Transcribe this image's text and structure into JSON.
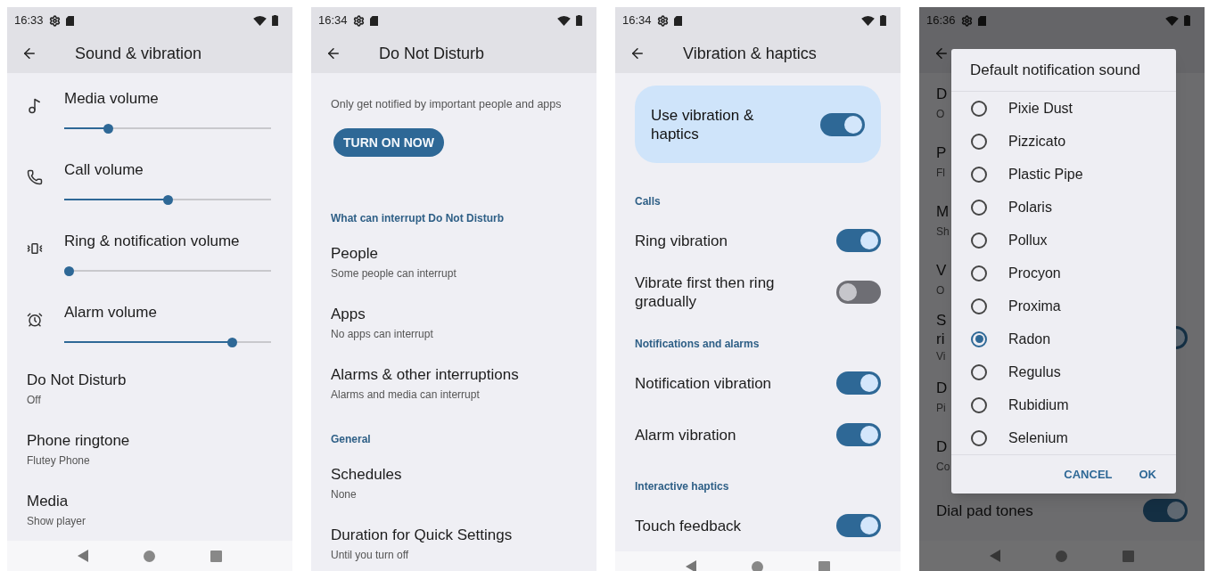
{
  "screens": [
    {
      "kind": "list",
      "time": "16:33",
      "title": "Sound & vibration",
      "items": [
        {
          "kind": "slider",
          "title": "Media volume",
          "level": 0.2
        },
        {
          "kind": "slider",
          "title": "Call volume",
          "level": 0.5
        },
        {
          "kind": "slider",
          "title": "Ring & notification volume",
          "level": 0
        },
        {
          "kind": "slider",
          "title": "Alarm volume",
          "level": 0.83
        },
        {
          "kind": "text",
          "title": "Do Not Disturb",
          "subtitle": "Off"
        },
        {
          "kind": "text",
          "title": "Phone ringtone",
          "subtitle": "Flutey Phone"
        },
        {
          "kind": "text",
          "title": "Media",
          "subtitle": "Show player"
        }
      ]
    },
    {
      "kind": "list",
      "time": "16:34",
      "title": "Do Not Disturb",
      "items": [
        {
          "kind": "note",
          "title": "Only get notified by important people and apps"
        },
        {
          "kind": "button",
          "title": "TURN ON NOW"
        },
        {
          "kind": "header",
          "title": "What can interrupt Do Not Disturb"
        },
        {
          "kind": "text",
          "title": "People",
          "subtitle": "Some people can interrupt"
        },
        {
          "kind": "text",
          "title": "Apps",
          "subtitle": "No apps can interrupt"
        },
        {
          "kind": "text",
          "title": "Alarms & other interruptions",
          "subtitle": "Alarms and media can interrupt"
        },
        {
          "kind": "header",
          "title": "General"
        },
        {
          "kind": "text",
          "title": "Schedules",
          "subtitle": "None"
        },
        {
          "kind": "text",
          "title": "Duration for Quick Settings",
          "subtitle": "Until you turn off"
        }
      ]
    },
    {
      "kind": "list",
      "time": "16:34",
      "title": "Vibration & haptics",
      "items": [
        {
          "kind": "card",
          "title": "Use vibration & haptics",
          "on": true
        },
        {
          "kind": "header",
          "title": "Calls"
        },
        {
          "kind": "switch",
          "title": "Ring vibration",
          "on": true
        },
        {
          "kind": "switch",
          "title": "Vibrate first then ring gradually",
          "on": false
        },
        {
          "kind": "header",
          "title": "Notifications and alarms"
        },
        {
          "kind": "switch",
          "title": "Notification vibration",
          "on": true
        },
        {
          "kind": "switch",
          "title": "Alarm vibration",
          "on": true
        },
        {
          "kind": "header",
          "title": "Interactive haptics"
        },
        {
          "kind": "switch",
          "title": "Touch feedback",
          "on": true
        }
      ]
    },
    {
      "kind": "dialog",
      "time": "16:36",
      "items": [
        {
          "kind": "text",
          "title": "D",
          "subtitle": "O"
        },
        {
          "kind": "text",
          "title": "P",
          "subtitle": "Fl"
        },
        {
          "kind": "text",
          "title": "M",
          "subtitle": "Sh"
        },
        {
          "kind": "text",
          "title": "V",
          "subtitle": "O"
        },
        {
          "kind": "switch",
          "title": "S",
          "title_line_2": "ri",
          "subtitle": "Vi",
          "on": true
        },
        {
          "kind": "text",
          "title": "D",
          "subtitle": "Pi"
        },
        {
          "kind": "text",
          "title": "D",
          "subtitle": "Co"
        },
        {
          "kind": "switch",
          "title": "Dial pad tones",
          "on": true
        }
      ],
      "dialog": {
        "title": "Default notification sound",
        "options": [
          {
            "label": "Pixie Dust",
            "selected": false
          },
          {
            "label": "Pizzicato",
            "selected": false
          },
          {
            "label": "Plastic Pipe",
            "selected": false
          },
          {
            "label": "Polaris",
            "selected": false
          },
          {
            "label": "Pollux",
            "selected": false
          },
          {
            "label": "Procyon",
            "selected": false
          },
          {
            "label": "Proxima",
            "selected": false
          },
          {
            "label": "Radon",
            "selected": true
          },
          {
            "label": "Regulus",
            "selected": false
          },
          {
            "label": "Rubidium",
            "selected": false
          },
          {
            "label": "Selenium",
            "selected": false
          }
        ],
        "buttons": [
          "CANCEL",
          "OK"
        ]
      }
    }
  ]
}
